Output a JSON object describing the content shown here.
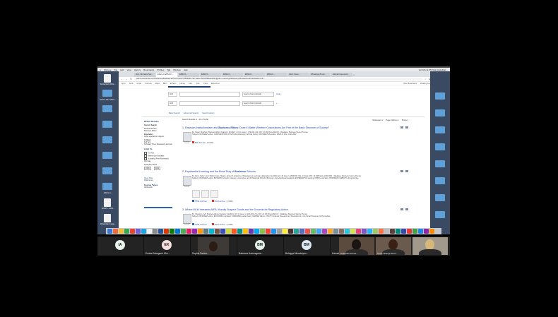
{
  "mac_menu": {
    "apple": "",
    "items": [
      "Chrome",
      "File",
      "Edit",
      "View",
      "History",
      "Bookmarks",
      "Profiles",
      "Tab",
      "Window",
      "Help"
    ],
    "right": "Ecl Mü 11:56  Kifah Abdelhäz..."
  },
  "desktop": {
    "icons": [
      {
        "label": "Screenshot 2021-...",
        "kind": "doc"
      },
      {
        "label": "Screen Shot 2021-...",
        "kind": "folder"
      },
      {
        "label": "",
        "kind": "folder"
      },
      {
        "label": "",
        "kind": "folder"
      },
      {
        "label": "",
        "kind": "folder"
      },
      {
        "label": "",
        "kind": "folder"
      },
      {
        "label": "",
        "kind": "folder"
      },
      {
        "label": "Ethics &...",
        "kind": "folder"
      },
      {
        "label": "IMGPS...HDR...",
        "kind": "doc"
      },
      {
        "label": "WhatsApp Image...",
        "kind": "doc"
      }
    ]
  },
  "browser": {
    "tabs": [
      "Hub...Brandeis Ses...",
      "Ethics in EBSCO ...",
      "EBSCO...",
      "EBSCO...",
      "EBSCO...",
      "EBSCO...",
      "EBSCO...",
      "stitch chose...",
      "WhatsApp Bmsd...",
      "Ethical Framework..."
    ],
    "url": "web.b.ebscohost.com/ehost/resultsadvanced?vid=7&sid=7985d29b-7fa7-4a3e-b563-8f6f4ea6e6f1@pdc-v-sessmgr03&bquery=Business+ethics&bdata=JmF...",
    "bookmarks": [
      "Apps",
      "SAIS",
      "Gmail",
      "YouTube",
      "Maps",
      "BBC",
      "EViews",
      "Library",
      "Jobs",
      "Jobs",
      "Trans",
      "Ebscohost",
      "Other Bookmarks",
      "Reading List"
    ]
  },
  "search_form": {
    "rows": [
      {
        "op": "AND",
        "field_label": "Select a Field (optional)",
        "action": "Clear"
      },
      {
        "op": "AND",
        "field_label": "Select a Field (optional)",
        "action": "+ -"
      }
    ],
    "links": [
      "Basic Search",
      "Advanced Search",
      "Search History"
    ]
  },
  "refine": {
    "title": "Refine Results",
    "current_search": "Current Search",
    "boolean_label": "Boolean/Phrase:",
    "boolean_value": "Business Ethics",
    "expanders": "Expanders",
    "expander_value": "Apply equivalent subjects",
    "limiters": "Limiters",
    "limiter_items": [
      "Full Text",
      "Scholarly (Peer Reviewed) Journals"
    ],
    "limit_to": "Limit To",
    "limit_items": [
      "Full Text",
      "References Available",
      "Scholarly (Peer Reviewed) Journals"
    ],
    "pub_date": "Publication Date",
    "from": "1989",
    "to": "2021",
    "show_more": "Show More",
    "options_set": "Options set",
    "source_types": "Source Types",
    "all_results": "All Results"
  },
  "results_header": {
    "count": "Search Results: 1 - 10 of 5,260",
    "relevance": "Relevance ▾",
    "page_options": "Page Options ▾",
    "share": "Share ▾"
  },
  "results": [
    {
      "number": "1.",
      "title_pre": "Rawlsian Institutionalism and",
      "title_bold": "Business Ethics",
      "title_post": ": Does It Matter Whether Corporations Are Part of the Basic Structure of Society?",
      "meta": "By: Singer, Abraham. Business Ethics Quarterly. Jan2021, Vol. 31 Issue 1, p79-100. 22p. DOI: 10.1017/beq.2020.15. , Database: Business Source Premier",
      "subjects": "Subjects: BUSINESS ethics; CORPORATIONS; POLITICAL philosophy; SOCIAL history; DISTRIBUTIVE justice; RAWLS, John, 1921-2002",
      "type": "Academic Journal",
      "links": [
        {
          "label": "PDF Full Text",
          "size": "(611KB)"
        }
      ]
    },
    {
      "number": "2.",
      "title_pre": "Experiential Learning and the Moral Duty of",
      "title_bold": "Business",
      "title_post": " Schools.",
      "meta": "By: Dunn, Kathy; Lord, Wright; Gioia, Hwang, Jamie M. Academy of Management Learning & Education. Dec2020, Vol. 19 Issue 4, p569-586. 18p. 4 Charts. DOI: 10.5465/amle.2019.0066. , Database: Business Source Premier",
      "subjects": "Subjects: BUSINESS ethics; BUSINESS schools; Colleges, Universities, and Professional Schools; Business; and educational standards; EXPERIENTIAL learning; MORAL education; BUSINESS COMPANY ethical practice",
      "type": "Academic Journal",
      "links": [
        {
          "label": "HTML Full Text",
          "size": ""
        },
        {
          "label": "PDF Full Text",
          "size": "(1.9MB)"
        }
      ]
    },
    {
      "number": "3.",
      "title_pre": "Where MLM Intersects MFA: Morally Suspect Goods and the Grounds for Regulatory Action.",
      "title_bold": "",
      "title_post": "",
      "meta": "By: Chapman, Jeff. Business Ethics Quarterly. Jan2021, Vol. 31 Issue 1, p160-186. 27p. DOI: 10.1017/beq.2020.10. , Database: Business Source Premier",
      "subjects": "Subjects: BUSINESS ethics; ECONOMIC regulation; INPROPER market theory; MARKET failure; UTILITY functions; Research and Development in the Social Sciences and Humanities",
      "type": "Academic Journal",
      "links": [
        {
          "label": "HTML Full Text",
          "size": ""
        },
        {
          "label": "PDF Full Text",
          "size": "(1.0MB)"
        }
      ]
    }
  ],
  "participants": [
    {
      "initials": "IA",
      "name": "",
      "color": "#e8f3ec"
    },
    {
      "initials": "EK",
      "name": "Emese Mangane Khe...",
      "color": "#f6dede"
    },
    {
      "initials": "",
      "name": "Sophie Sahba...",
      "color": "",
      "video": true
    },
    {
      "initials": "BM",
      "name": "Bakuuna Hamnagona...",
      "color": "#dff1e6"
    },
    {
      "initials": "BM",
      "name": "Boldyga Mirzabeyev...",
      "color": "#dcebf6"
    },
    {
      "initials": "KI",
      "name": "Kamala Ismayilova",
      "color": "#f6dede"
    },
    {
      "initials": "MS",
      "name": "Mars Suleymanova",
      "color": "#efe1f6"
    }
  ],
  "video_tiles": [
    {
      "name": "Mujibullah Ahmed..."
    },
    {
      "name": "Huma Jahangir Khou..."
    },
    {
      "name": ""
    }
  ],
  "colors": {
    "link_blue": "#20479b",
    "ebsco_navy": "#1d3c6e",
    "pdf_red": "#d4372c"
  }
}
